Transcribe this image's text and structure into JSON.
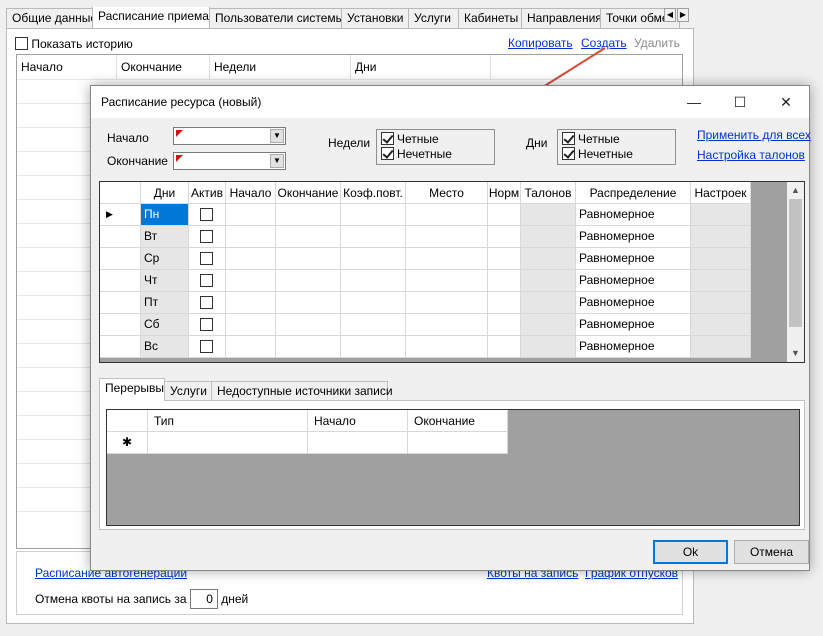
{
  "background": {
    "tabs": [
      "Общие данные",
      "Расписание приема",
      "Пользователи системы",
      "Установки",
      "Услуги",
      "Кабинеты",
      "Направления",
      "Точки обме"
    ],
    "active_tab": "Расписание приема",
    "show_history_label": "Показать историю",
    "actions": {
      "copy": "Копировать",
      "create": "Создать",
      "delete": "Удалить"
    },
    "grid_columns": [
      "Начало",
      "Окончание",
      "Недели",
      "Дни"
    ],
    "autogen_link": "Расписание автогенерации",
    "quota_link": "Квоты на запись",
    "vacation_link": "График отпусков",
    "quota_cancel_label": "Отмена квоты на запись за",
    "quota_cancel_value": "0",
    "quota_cancel_unit": "дней"
  },
  "dialog": {
    "title": "Расписание ресурса (новый)",
    "start_label": "Начало",
    "end_label": "Окончание",
    "weeks_label": "Недели",
    "weeks": {
      "even": "Четные",
      "odd": "Нечетные",
      "even_checked": true,
      "odd_checked": true
    },
    "days_label": "Дни",
    "days": {
      "even": "Четные",
      "odd": "Нечетные",
      "even_checked": true,
      "odd_checked": true
    },
    "apply_all_link": "Применить для всех",
    "tickets_link": "Настройка талонов",
    "grid": {
      "columns": [
        "Дни",
        "Актив",
        "Начало",
        "Окончание",
        "Коэф.повт.",
        "Место",
        "Норм",
        "Талонов",
        "Распределение",
        "Настроек"
      ],
      "rows": [
        {
          "day": "Пн",
          "active": false,
          "distribution": "Равномерное"
        },
        {
          "day": "Вт",
          "active": false,
          "distribution": "Равномерное"
        },
        {
          "day": "Ср",
          "active": false,
          "distribution": "Равномерное"
        },
        {
          "day": "Чт",
          "active": false,
          "distribution": "Равномерное"
        },
        {
          "day": "Пт",
          "active": false,
          "distribution": "Равномерное"
        },
        {
          "day": "Сб",
          "active": false,
          "distribution": "Равномерное"
        },
        {
          "day": "Вс",
          "active": false,
          "distribution": "Равномерное"
        }
      ]
    },
    "lower_tabs": [
      "Перерывы",
      "Услуги",
      "Недоступные источники записи"
    ],
    "lower_active_tab": "Перерывы",
    "breaks_grid": {
      "columns": [
        "Тип",
        "Начало",
        "Окончание"
      ],
      "new_row_marker": "✱"
    },
    "ok_label": "Ok",
    "cancel_label": "Отмена"
  },
  "colors": {
    "accent": "#0078d7",
    "link": "#0033cc",
    "arrow": "#d94a3a"
  }
}
